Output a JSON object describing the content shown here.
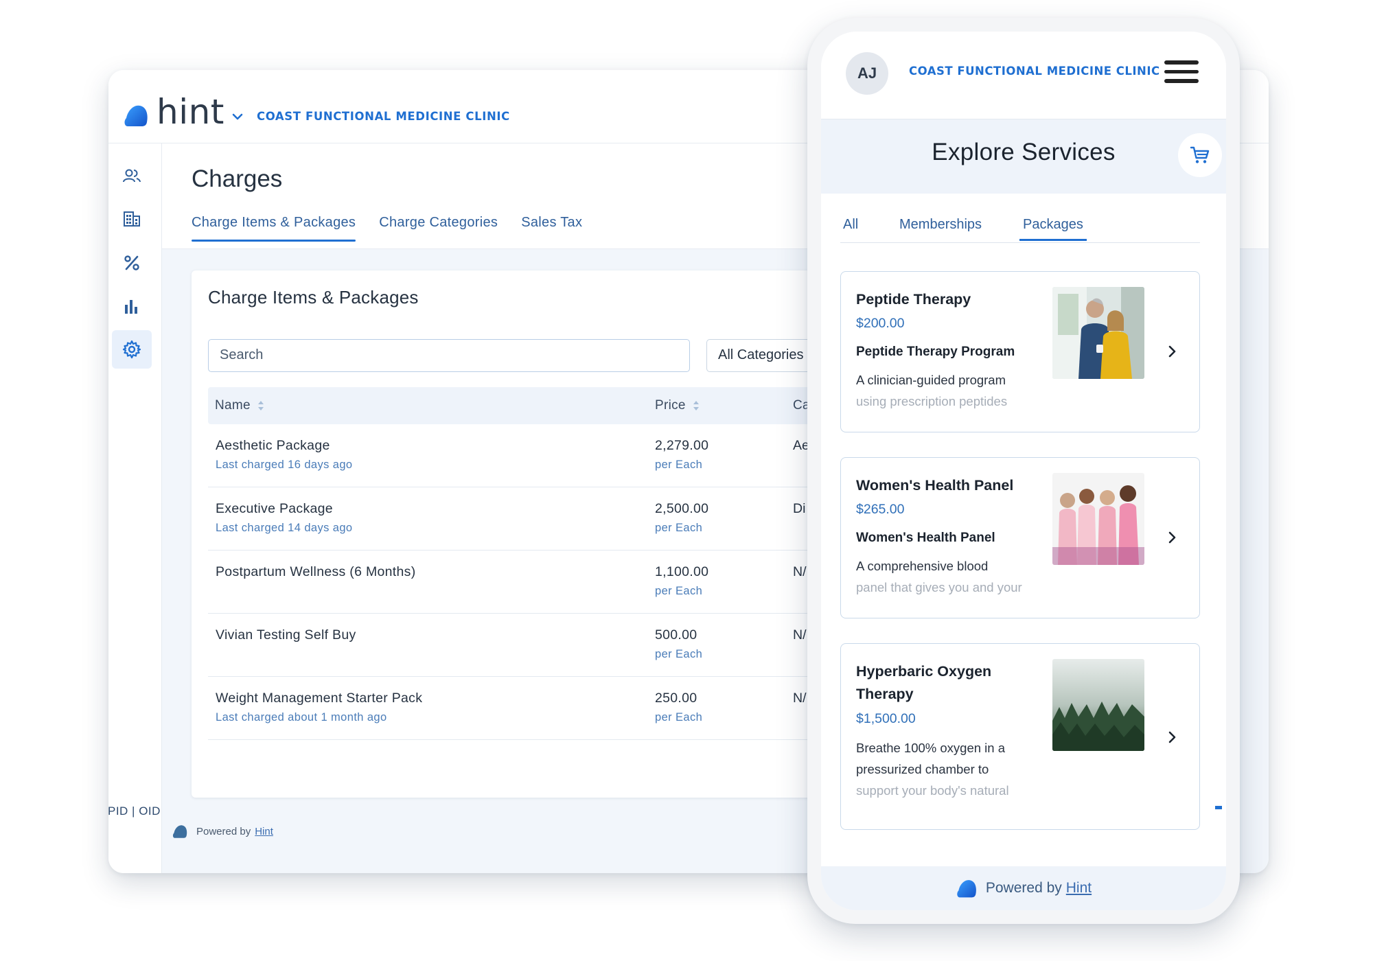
{
  "desktop": {
    "logo_text": "hint",
    "clinic_name": "COAST FUNCTIONAL MEDICINE CLINIC",
    "page_title": "Charges",
    "tabs": [
      {
        "label": "Charge Items & Packages",
        "active": true
      },
      {
        "label": "Charge Categories",
        "active": false
      },
      {
        "label": "Sales Tax",
        "active": false
      }
    ],
    "card_title": "Charge Items & Packages",
    "search_placeholder": "Search",
    "category_filter": "All Categories",
    "columns": {
      "name": "Name",
      "price": "Price",
      "category": "Ca"
    },
    "rows": [
      {
        "name": "Aesthetic Package",
        "sub": "Last charged 16 days ago",
        "price": "2,279.00",
        "unit": "per Each",
        "category": "Ae"
      },
      {
        "name": "Executive Package",
        "sub": "Last charged 14 days ago",
        "price": "2,500.00",
        "unit": "per Each",
        "category": "Di"
      },
      {
        "name": "Postpartum Wellness (6 Months)",
        "sub": "",
        "price": "1,100.00",
        "unit": "per Each",
        "category": "N/"
      },
      {
        "name": "Vivian Testing Self Buy",
        "sub": "",
        "price": "500.00",
        "unit": "per Each",
        "category": "N/"
      },
      {
        "name": "Weight Management Starter Pack",
        "sub": "Last charged about 1 month ago",
        "price": "250.00",
        "unit": "per Each",
        "category": "N/"
      }
    ],
    "pid_oid": "PID | OID",
    "powered_prefix": "Powered by",
    "powered_link": "Hint"
  },
  "phone": {
    "avatar_initials": "AJ",
    "clinic_name": "COAST FUNCTIONAL MEDICINE CLINIC",
    "title": "Explore Services",
    "tabs": [
      {
        "label": "All",
        "active": false
      },
      {
        "label": "Memberships",
        "active": false
      },
      {
        "label": "Packages",
        "active": true
      }
    ],
    "services": [
      {
        "name": "Peptide Therapy",
        "price": "$200.00",
        "program": "Peptide Therapy Program",
        "desc": "A clinician-guided program",
        "desc_fade": "using prescription peptides"
      },
      {
        "name": "Women's Health Panel",
        "price": "$265.00",
        "program": "Women's Health Panel",
        "desc": "A comprehensive blood",
        "desc_fade": "panel that gives you and your"
      },
      {
        "name": "Hyperbaric Oxygen Therapy",
        "price": "$1,500.00",
        "program": "",
        "desc": "Breathe 100% oxygen in a pressurized chamber to",
        "desc_fade": "support your body's natural"
      }
    ],
    "powered_prefix": "Powered by",
    "powered_link": "Hint"
  },
  "colors": {
    "brand_blue": "#1f6fd1",
    "link_blue": "#2f5f9b",
    "band": "#eef3fa"
  }
}
